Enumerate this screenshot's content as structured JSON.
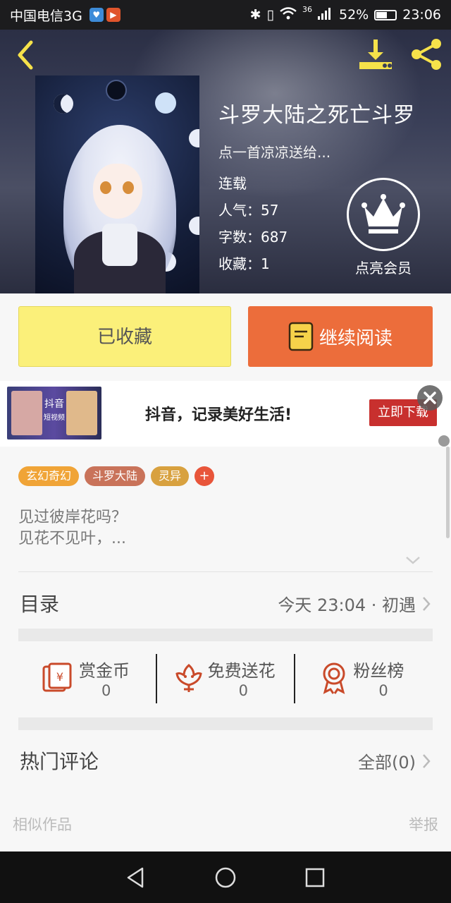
{
  "status": {
    "carrier": "中国电信3G",
    "network": "36",
    "battery": "52%",
    "time": "23:06",
    "battery_level": 0.52
  },
  "header": {
    "title": "斗罗大陆之死亡斗罗",
    "subtitle": "点一首凉凉送给...",
    "status": "连载",
    "popularity": "人气：57",
    "word_count": "字数：687",
    "favorites": "收藏：1",
    "vip_label": "点亮会员"
  },
  "actions": {
    "favorited_label": "已收藏",
    "continue_label": "继续阅读"
  },
  "ad": {
    "text": "抖音，记录美好生活!",
    "cta": "立即下载",
    "logo_text": "抖音",
    "logo_sub": "短视频"
  },
  "tags": [
    {
      "label": "玄幻奇幻",
      "color": "#f0a437"
    },
    {
      "label": "斗罗大陆",
      "color": "#c9735a"
    },
    {
      "label": "灵异",
      "color": "#d8a13f"
    }
  ],
  "tag_add": "+",
  "intro": {
    "line1": "见过彼岸花吗？",
    "line2": "见花不见叶，..."
  },
  "catalog": {
    "title": "目录",
    "latest": "今天 23:04 · 初遇"
  },
  "stats": [
    {
      "label": "赏金币",
      "value": "0",
      "icon": "envelope-coin-icon"
    },
    {
      "label": "免费送花",
      "value": "0",
      "icon": "flower-icon"
    },
    {
      "label": "粉丝榜",
      "value": "0",
      "icon": "medal-icon"
    }
  ],
  "comments": {
    "title": "热门评论",
    "all": "全部(0)"
  },
  "footer": {
    "similar": "相似作品",
    "report": "举报"
  },
  "colors": {
    "accent_orange": "#ec6d3b",
    "fav_yellow": "#fbf07a",
    "icon_yellow": "#f6e24a",
    "icon_red": "#c94a2a"
  }
}
